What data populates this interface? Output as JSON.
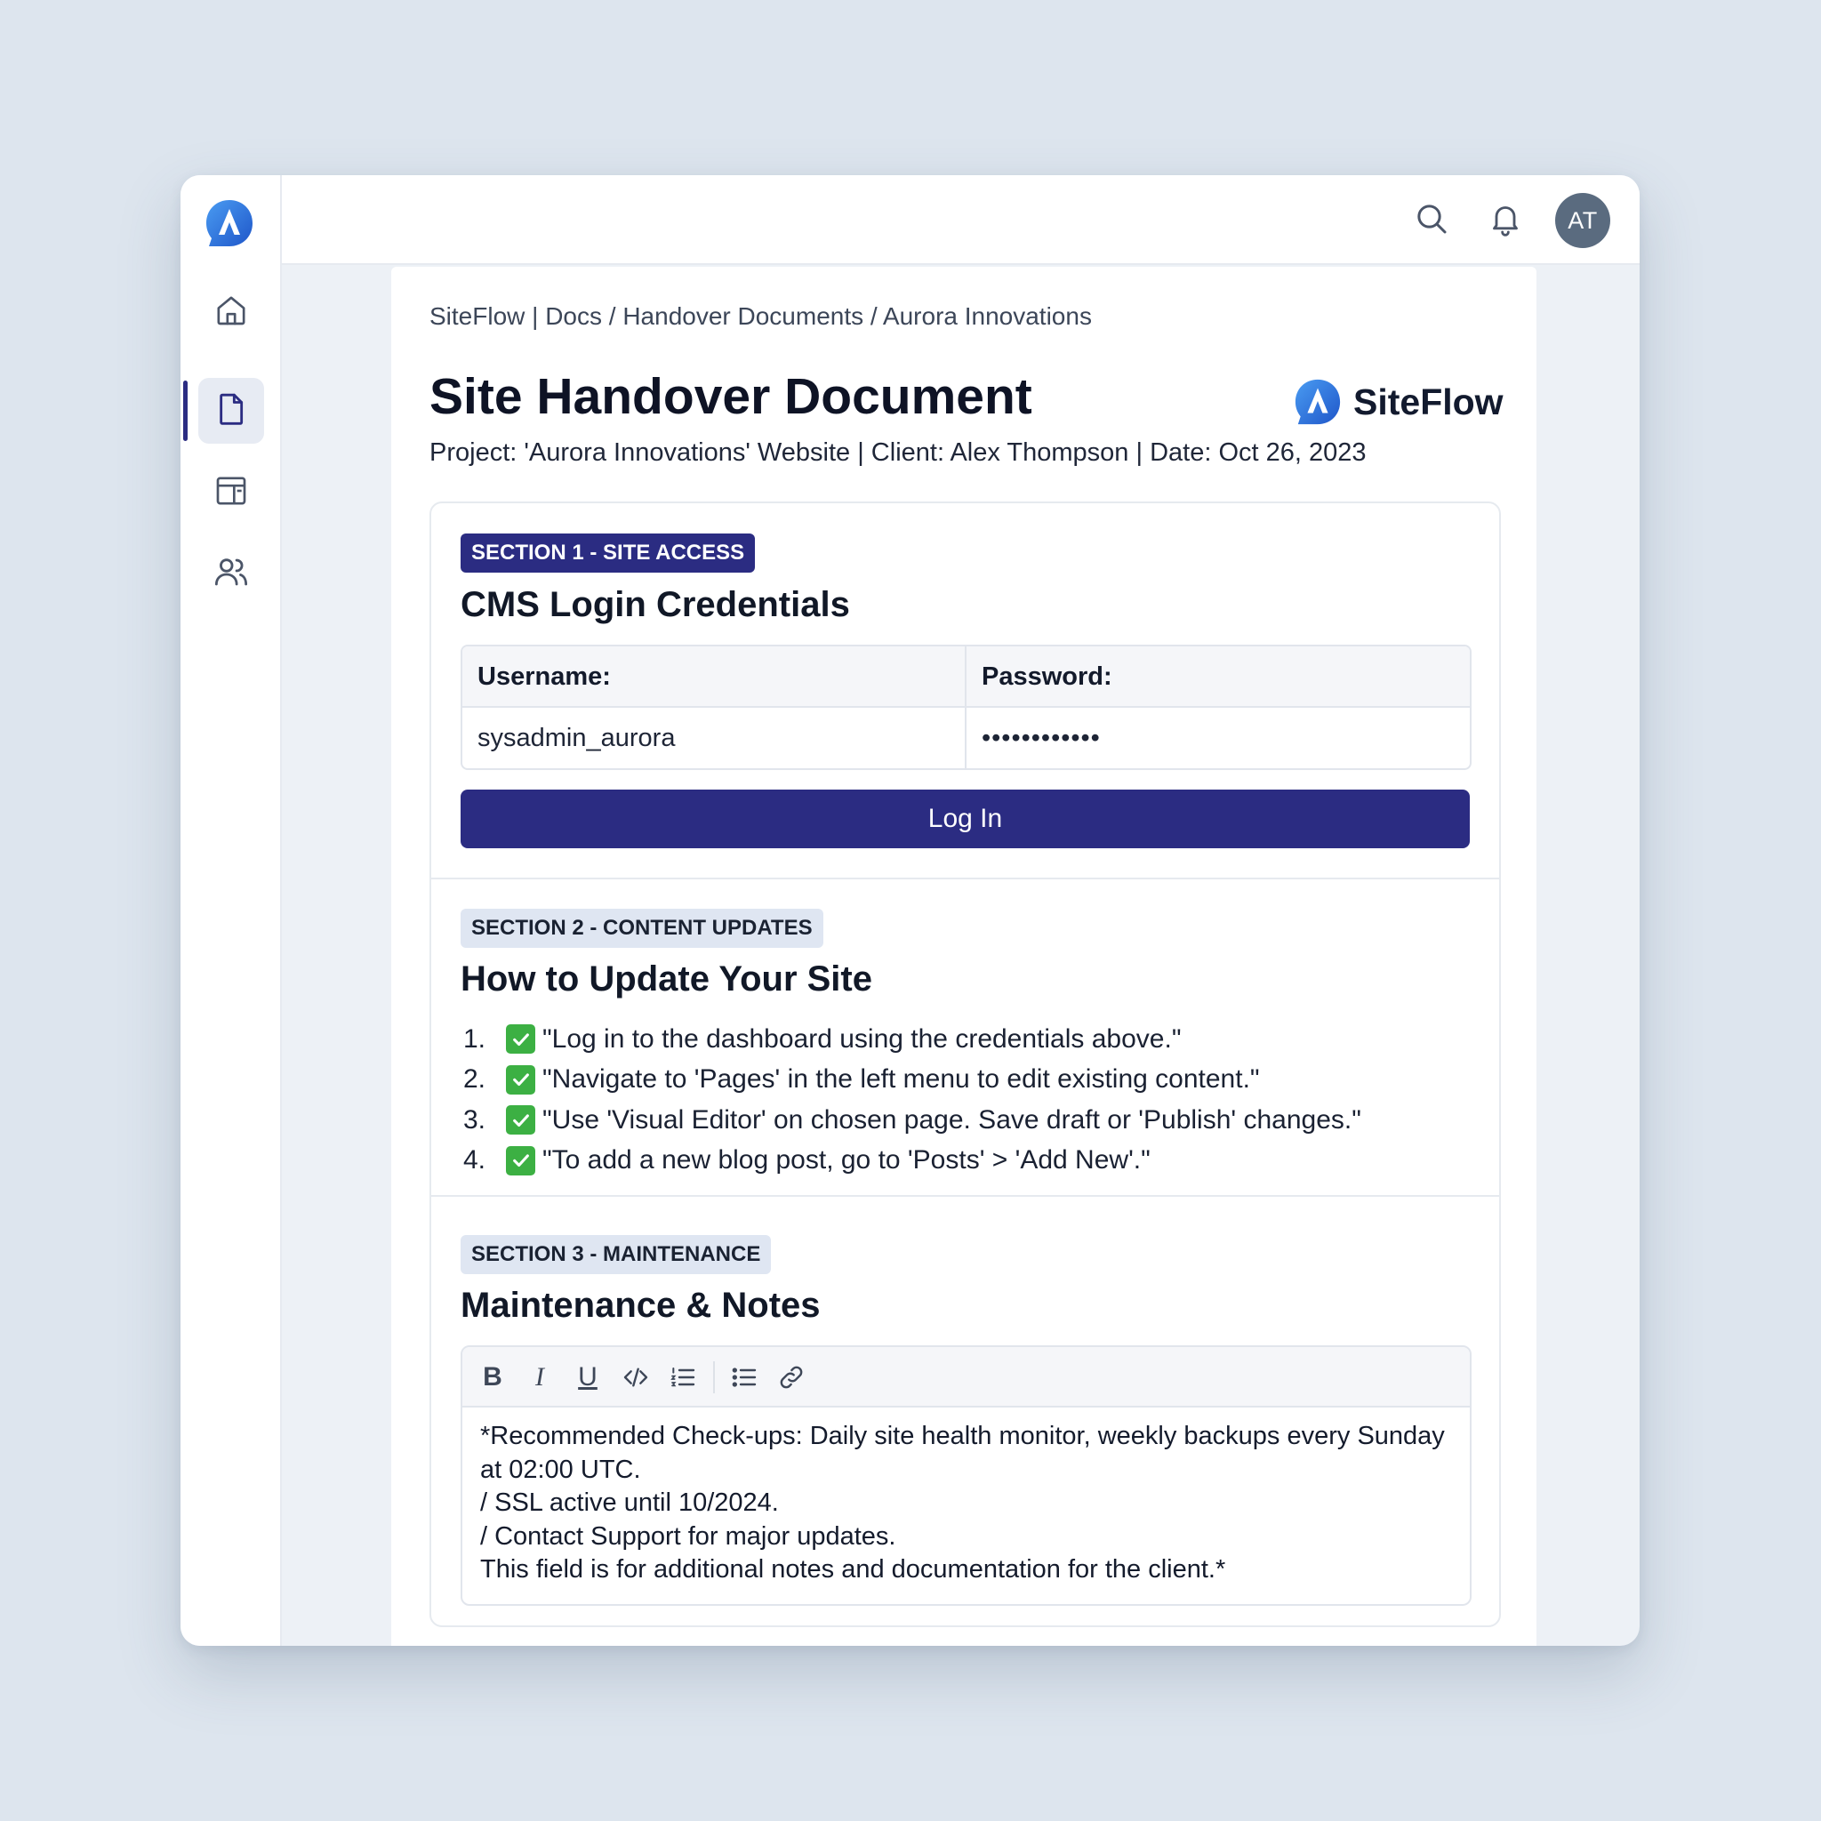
{
  "app": {
    "brand_name": "SiteFlow",
    "colors": {
      "accent": "#2b2c82",
      "logo_blue": "#2a6de0",
      "check_green": "#3cb043",
      "background": "#dde5ee"
    }
  },
  "sidebar": {
    "items": [
      {
        "name": "home",
        "icon": "home-icon",
        "active": false
      },
      {
        "name": "documents",
        "icon": "document-icon",
        "active": true
      },
      {
        "name": "pages",
        "icon": "layout-icon",
        "active": false
      },
      {
        "name": "users",
        "icon": "users-icon",
        "active": false
      }
    ]
  },
  "topbar": {
    "icons": [
      "search-icon",
      "bell-icon"
    ],
    "avatar_initials": "AT"
  },
  "doc": {
    "breadcrumb": "SiteFlow | Docs / Handover Documents / Aurora Innovations",
    "title": "Site Handover Document",
    "meta": "Project: 'Aurora Innovations' Website | Client: Alex Thompson | Date: Oct 26, 2023",
    "brand_name": "SiteFlow"
  },
  "section1": {
    "badge": "SECTION 1 - SITE ACCESS",
    "title": "CMS Login Credentials",
    "username_label": "Username:",
    "password_label": "Password:",
    "username_value": "sysadmin_aurora",
    "password_value": "••••••••••••",
    "login_button": "Log In"
  },
  "section2": {
    "badge": "SECTION 2 - CONTENT UPDATES",
    "title": "How to Update Your Site",
    "steps": [
      {
        "num": "1.",
        "text": "\"Log in to the dashboard using the credentials above.\""
      },
      {
        "num": "2.",
        "text": "\"Navigate to 'Pages' in the left menu to edit existing content.\""
      },
      {
        "num": "3.",
        "text": "\"Use 'Visual Editor' on chosen page. Save draft or 'Publish' changes.\""
      },
      {
        "num": "4.",
        "text": "\"To add a new blog post, go to 'Posts' > 'Add New'.\""
      }
    ]
  },
  "section3": {
    "badge": "SECTION 3 - MAINTENANCE",
    "title": "Maintenance & Notes",
    "toolbar": [
      "bold",
      "italic",
      "underline",
      "code",
      "ordered-list",
      "bullet-list",
      "link"
    ],
    "toolbar_labels": {
      "bold": "B",
      "italic": "I",
      "underline": "U"
    },
    "notes": [
      "*Recommended Check-ups: Daily site health monitor, weekly backups every Sunday",
      "at 02:00 UTC.",
      "/ SSL active until 10/2024.",
      "/ Contact Support for major updates.",
      "This field is for additional notes and documentation for the client.*"
    ]
  }
}
